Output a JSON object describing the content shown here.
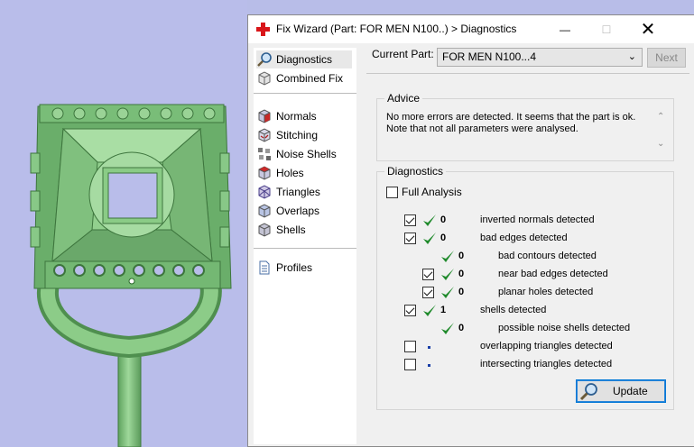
{
  "window": {
    "title": "Fix Wizard (Part: FOR MEN N100..) > Diagnostics",
    "minimize_glyph": "—",
    "maximize_glyph": "☐",
    "close_glyph": "✕"
  },
  "nav": {
    "items": [
      {
        "label": "Diagnostics",
        "icon": "magnifier-icon",
        "selected": true
      },
      {
        "label": "Combined Fix",
        "icon": "box-icon",
        "selected": false
      },
      {
        "label": "Normals",
        "icon": "normals-cube-icon",
        "selected": false
      },
      {
        "label": "Stitching",
        "icon": "stitching-cube-icon",
        "selected": false
      },
      {
        "label": "Noise Shells",
        "icon": "noise-shells-icon",
        "selected": false
      },
      {
        "label": "Holes",
        "icon": "holes-cube-icon",
        "selected": false
      },
      {
        "label": "Triangles",
        "icon": "triangles-cube-icon",
        "selected": false
      },
      {
        "label": "Overlaps",
        "icon": "overlaps-cube-icon",
        "selected": false
      },
      {
        "label": "Shells",
        "icon": "shells-cube-icon",
        "selected": false
      },
      {
        "label": "Profiles",
        "icon": "document-icon",
        "selected": false
      }
    ]
  },
  "current_part": {
    "label": "Current Part:",
    "value": "FOR MEN N100...4"
  },
  "next_label": "Next",
  "advice": {
    "title": "Advice",
    "text_line1": "No more errors are detected. It seems that the part is ok.",
    "text_line2": "Note that not all parameters were analysed."
  },
  "diagnostics": {
    "title": "Diagnostics",
    "full_analysis_label": "Full Analysis",
    "full_analysis_checked": false,
    "rows": [
      {
        "checkbox": true,
        "checked": true,
        "status": "ok",
        "count": "0",
        "desc": "inverted normals detected",
        "indent": 0
      },
      {
        "checkbox": true,
        "checked": true,
        "status": "ok",
        "count": "0",
        "desc": "bad edges detected",
        "indent": 0
      },
      {
        "checkbox": false,
        "checked": false,
        "status": "ok",
        "count": "0",
        "desc": "bad contours detected",
        "indent": 1
      },
      {
        "checkbox": true,
        "checked": true,
        "status": "ok",
        "count": "0",
        "desc": "near bad edges detected",
        "indent": 1
      },
      {
        "checkbox": true,
        "checked": true,
        "status": "ok",
        "count": "0",
        "desc": "planar holes detected",
        "indent": 1
      },
      {
        "checkbox": true,
        "checked": true,
        "status": "ok",
        "count": "1",
        "desc": "shells detected",
        "indent": 0
      },
      {
        "checkbox": false,
        "checked": false,
        "status": "ok",
        "count": "0",
        "desc": "possible noise shells detected",
        "indent": 1
      },
      {
        "checkbox": true,
        "checked": false,
        "status": "pending",
        "count": "",
        "desc": "overlapping triangles detected",
        "indent": 0
      },
      {
        "checkbox": true,
        "checked": false,
        "status": "pending",
        "count": "",
        "desc": "intersecting triangles detected",
        "indent": 0
      }
    ]
  },
  "update_label": "Update",
  "colors": {
    "viewport_bg": "#b9bdea",
    "model_green": "#7fc47f",
    "ok_tick": "#1f8a2b",
    "accent": "#0078d7"
  }
}
